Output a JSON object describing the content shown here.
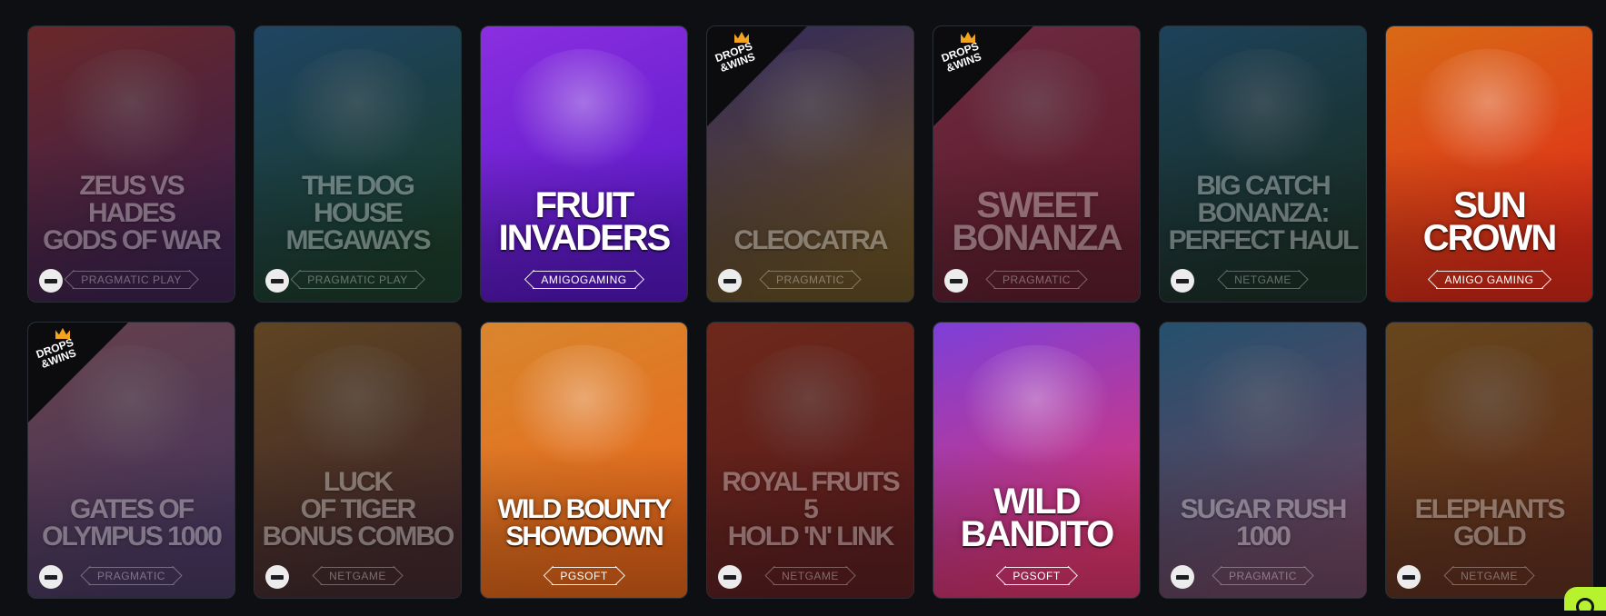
{
  "badge": {
    "line1": "DROPS",
    "line2": "&WINS"
  },
  "games": [
    {
      "title": "ZEUS vs HADES\nGODS OF WAR",
      "provider": "PRAGMATIC PLAY",
      "disabled": true,
      "drops": false,
      "bg": [
        "#e0433f",
        "#6f2a8c"
      ],
      "size": "sm"
    },
    {
      "title": "THE DOG HOUSE\nMEGAWAYS",
      "provider": "PRAGMATIC PLAY",
      "disabled": true,
      "drops": false,
      "bg": [
        "#2f86c8",
        "#1e6b36"
      ],
      "size": "sm"
    },
    {
      "title": "FRUIT\nINVADERS",
      "provider": "AMIGOGAMING",
      "disabled": false,
      "drops": false,
      "bg": [
        "#8a2fe0",
        "#5b18c9"
      ],
      "size": "lg"
    },
    {
      "title": "CLEOCATRA",
      "provider": "PRAGMATIC",
      "disabled": true,
      "drops": true,
      "bg": [
        "#5a43b8",
        "#d69a2a"
      ],
      "size": "sm"
    },
    {
      "title": "SWEET\nBONANZA",
      "provider": "PRAGMATIC",
      "disabled": true,
      "drops": true,
      "bg": [
        "#e94a7a",
        "#c01f3c"
      ],
      "size": "lg"
    },
    {
      "title": "BIG CATCH BONANZA:\nPERFECT HAUL",
      "provider": "NETGAME",
      "disabled": true,
      "drops": false,
      "bg": [
        "#2a7fb0",
        "#1d4a2b"
      ],
      "size": "sm"
    },
    {
      "title": "SUN CROWN",
      "provider": "AMIGO GAMING",
      "disabled": false,
      "drops": false,
      "bg": [
        "#d86a16",
        "#e02a18"
      ],
      "size": "lg"
    },
    {
      "title": "GATES OF\nOLYMPUS 1000",
      "provider": "PRAGMATIC",
      "disabled": true,
      "drops": true,
      "bg": [
        "#d87b8c",
        "#8a5fb8"
      ],
      "size": "sm"
    },
    {
      "title": "LUCK\nOF TIGER\nBONUS COMBO",
      "provider": "NETGAME",
      "disabled": true,
      "drops": false,
      "bg": [
        "#c7862d",
        "#7a3a3a"
      ],
      "size": "sm"
    },
    {
      "title": "WILD BOUNTY\nSHOWDOWN",
      "provider": "PGSOFT",
      "disabled": false,
      "drops": false,
      "bg": [
        "#d8862e",
        "#e9671a"
      ],
      "size": "sm"
    },
    {
      "title": "ROYAL FRUITS 5\nHOLD 'N' LINK",
      "provider": "NETGAME",
      "disabled": true,
      "drops": false,
      "bg": [
        "#e8431c",
        "#b8201a"
      ],
      "size": "sm"
    },
    {
      "title": "WILD\nBANDITO",
      "provider": "PGSOFT",
      "disabled": false,
      "drops": false,
      "bg": [
        "#7d3fd8",
        "#e0356f"
      ],
      "size": "lg"
    },
    {
      "title": "SUGAR RUSH\n1000",
      "provider": "PRAGMATIC",
      "disabled": true,
      "drops": false,
      "bg": [
        "#3aa1e0",
        "#e07fb8"
      ],
      "size": "sm"
    },
    {
      "title": "ELEPHANTS\nGOLD",
      "provider": "NETGAME",
      "disabled": true,
      "drops": false,
      "bg": [
        "#d8891e",
        "#c44a18"
      ],
      "size": "sm"
    }
  ],
  "colors": {
    "page_bg": "#0d0f12",
    "accent": "#b7f22e"
  },
  "icons": {
    "blocked": "no-entry-icon",
    "search": "search-icon",
    "drops": "crown-icon"
  }
}
